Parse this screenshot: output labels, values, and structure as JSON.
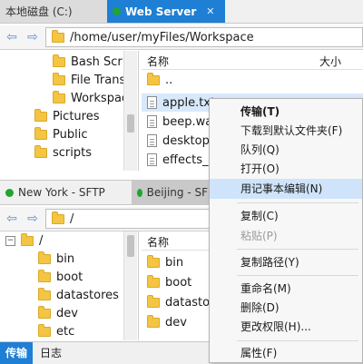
{
  "top_tabs": [
    {
      "label": "本地磁盘 (C:)"
    },
    {
      "label": "Web Server"
    }
  ],
  "top_path": "/home/user/myFiles/Workspace",
  "top_tree": [
    "Bash Scrip",
    "File Transf",
    "Workspac",
    "Pictures",
    "Public",
    "scripts"
  ],
  "top_list": {
    "col_name": "名称",
    "col_size": "大小",
    "items": [
      "..",
      "apple.txt",
      "beep.wav",
      "desktop.",
      "effects_sa"
    ]
  },
  "bottom_tabs": [
    {
      "label": "New York - SFTP"
    },
    {
      "label": "Beijing - SF"
    }
  ],
  "bottom_path": "/",
  "bottom_tree": [
    "/",
    "bin",
    "boot",
    "datastores",
    "dev",
    "etc"
  ],
  "bottom_list": {
    "col_name": "名称",
    "items": [
      "bin",
      "boot",
      "datastore",
      "dev"
    ]
  },
  "context_menu": {
    "items": [
      "传输(T)",
      "下载到默认文件夹(F)",
      "队列(Q)",
      "打开(O)",
      "用记事本编辑(N)",
      "复制(C)",
      "粘贴(P)",
      "复制路径(Y)",
      "重命名(M)",
      "删除(D)",
      "更改权限(H)...",
      "属性(F)"
    ]
  },
  "bottom_bar": {
    "tabs": [
      "传输",
      "日志"
    ]
  }
}
